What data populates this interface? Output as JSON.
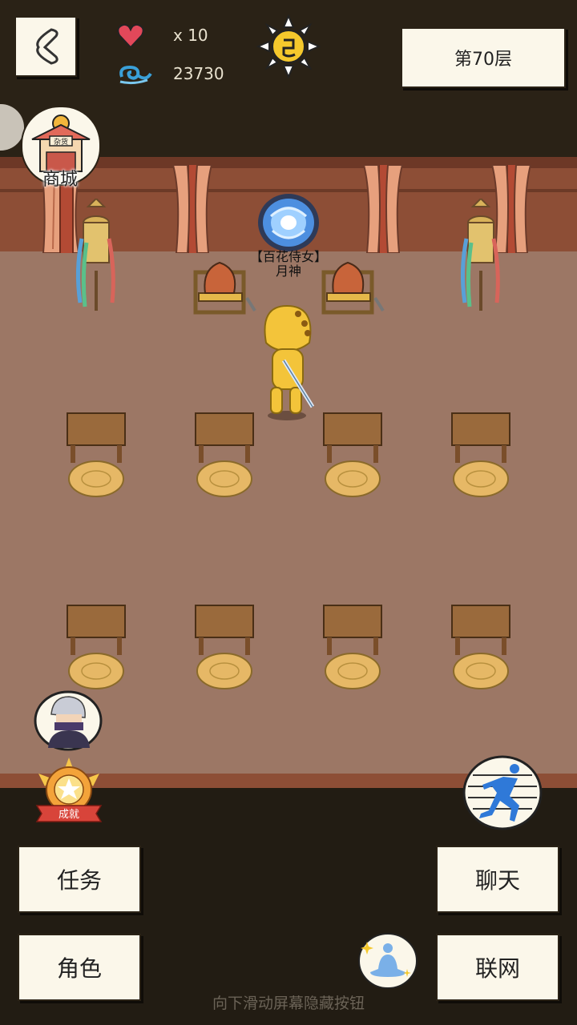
{
  "hud": {
    "lives": "x 10",
    "coins": "23730",
    "floor_label": "第70层"
  },
  "shop": {
    "label": "商城",
    "sign_text": "杂货"
  },
  "npc": {
    "title": "【百花侍女】",
    "name": "月神"
  },
  "actions": {
    "task": "任务",
    "chat": "聊天",
    "character": "角色",
    "network": "联网",
    "achievement": "成就"
  },
  "hint": "向下滑动屏幕隐藏按钮",
  "colors": {
    "hud_bg": "#2a2216",
    "wall": "#8d4e36",
    "floor": "#9c7765",
    "paper": "#fbf7ea",
    "hero_yellow": "#f3c43a"
  }
}
